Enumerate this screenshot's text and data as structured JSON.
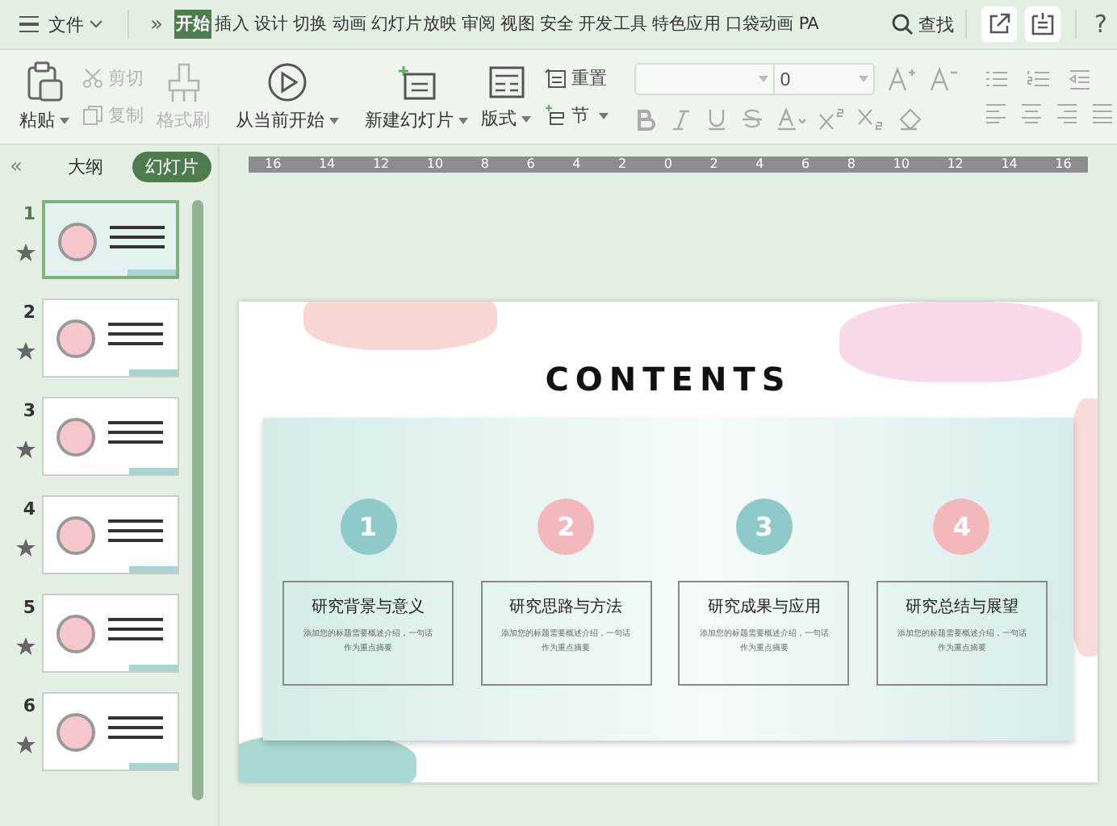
{
  "menu": {
    "file_label": "文件",
    "more": "»",
    "tabs": [
      {
        "label": "开始",
        "selected": true
      },
      {
        "label": "插入",
        "selected": false
      },
      {
        "label": "设计",
        "selected": false
      },
      {
        "label": "切换",
        "selected": false
      },
      {
        "label": "动画",
        "selected": false
      },
      {
        "label": "幻灯片放映",
        "selected": false
      },
      {
        "label": "审阅",
        "selected": false
      },
      {
        "label": "视图",
        "selected": false
      },
      {
        "label": "安全",
        "selected": false
      },
      {
        "label": "开发工具",
        "selected": false
      },
      {
        "label": "特色应用",
        "selected": false
      },
      {
        "label": "口袋动画",
        "selected": false
      },
      {
        "label": "PA",
        "selected": false
      }
    ],
    "search": "查找",
    "help": "?"
  },
  "ribbon": {
    "paste": "粘贴",
    "clip": [
      {
        "label": "剪切",
        "disabled": true
      },
      {
        "label": "复制",
        "disabled": true
      }
    ],
    "format_painter": {
      "label": "格式刷",
      "disabled": true
    },
    "play": "从当前开始",
    "new_slide": "新建幻灯片",
    "layout": "版式",
    "reset": "重置",
    "section": "节",
    "font_size": "0"
  },
  "ruler": [
    "16",
    "14",
    "12",
    "10",
    "8",
    "6",
    "4",
    "2",
    "0",
    "2",
    "4",
    "6",
    "8",
    "10",
    "12",
    "14",
    "16"
  ],
  "panel": {
    "collapse": "«",
    "tabs": [
      {
        "label": "大纲",
        "selected": false
      },
      {
        "label": "幻灯片",
        "selected": true
      }
    ],
    "slides": [
      {
        "number": "1",
        "selected": true
      },
      {
        "number": "2",
        "selected": false
      },
      {
        "number": "3",
        "selected": false
      },
      {
        "number": "4",
        "selected": false
      },
      {
        "number": "5",
        "selected": false
      },
      {
        "number": "6",
        "selected": false
      }
    ]
  },
  "slide": {
    "title": "CONTENTS",
    "items": [
      {
        "number": "1",
        "color": "#8fcac8",
        "title": "研究背景与意义",
        "description": "添加您的标题需要概述介绍，一句话作为重点摘要"
      },
      {
        "number": "2",
        "color": "#f2b8bb",
        "title": "研究思路与方法",
        "description": "添加您的标题需要概述介绍，一句话作为重点摘要"
      },
      {
        "number": "3",
        "color": "#8fcac8",
        "title": "研究成果与应用",
        "description": "添加您的标题需要概述介绍，一句话作为重点摘要"
      },
      {
        "number": "4",
        "color": "#f2b8bb",
        "title": "研究总结与展望",
        "description": "添加您的标题需要概述介绍，一句话作为重点摘要"
      }
    ]
  }
}
